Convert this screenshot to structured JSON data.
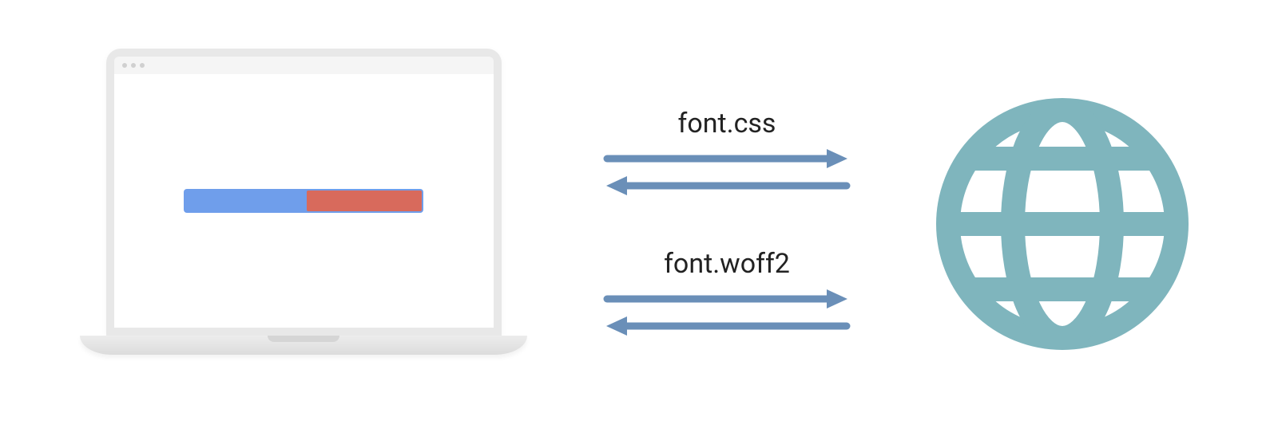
{
  "requests": {
    "first": {
      "label": "font.css"
    },
    "second": {
      "label": "font.woff2"
    }
  },
  "colors": {
    "arrow": "#6a8fb8",
    "globe": "#7fb5bd",
    "progress_bg": "#6f9eeb",
    "progress_fill": "#d86a5c"
  }
}
